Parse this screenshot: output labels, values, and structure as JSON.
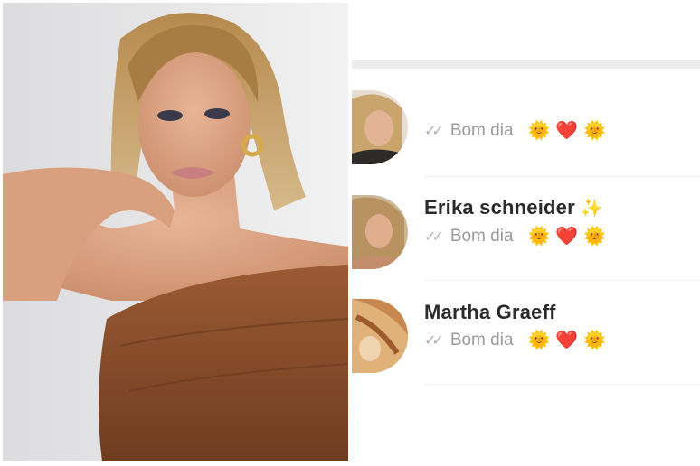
{
  "chats": [
    {
      "name": "",
      "last_message": "Bom dia",
      "emojis": [
        "🌞",
        "❤️",
        "🌞"
      ],
      "read_status": "double-check-icon"
    },
    {
      "name": "Erika schneider",
      "name_emoji": "✨",
      "last_message": "Bom dia",
      "emojis": [
        "🌞",
        "❤️",
        "🌞"
      ],
      "read_status": "double-check-icon"
    },
    {
      "name": "Martha Graeff",
      "last_message": "Bom dia",
      "emojis": [
        "🌞",
        "❤️",
        "🌞"
      ],
      "read_status": "double-check-icon"
    }
  ],
  "ticks": "✓✓"
}
